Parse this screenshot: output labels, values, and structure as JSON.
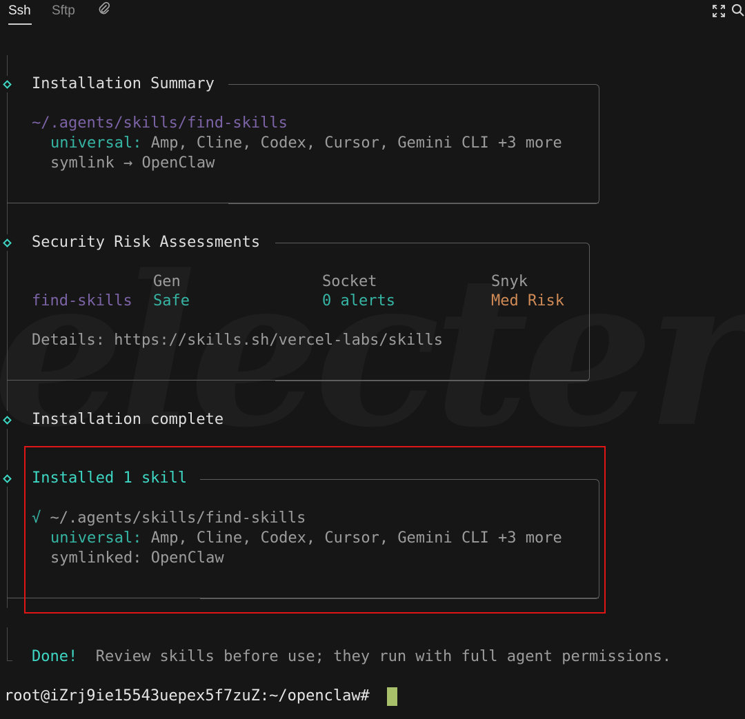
{
  "tabs": [
    {
      "label": "Ssh",
      "active": true
    },
    {
      "label": "Sftp",
      "active": false
    }
  ],
  "toolbar_icons": {
    "attach": "paperclip-icon",
    "fullscreen": "expand-icon",
    "search": "search-icon"
  },
  "watermark": "electerm",
  "summary": {
    "title": "Installation Summary",
    "path": "~/.agents/skills/find-skills",
    "universal_label": "universal:",
    "agents": " Amp, Cline, Codex, Cursor, Gemini CLI +3 more",
    "symlink": "symlink → OpenClaw"
  },
  "security": {
    "title": "Security Risk Assessments",
    "headers": {
      "gen": "Gen",
      "socket": "Socket",
      "snyk": "Snyk"
    },
    "row": {
      "name": "find-skills",
      "gen": "Safe",
      "socket": "0 alerts",
      "snyk": "Med Risk"
    },
    "details": "Details: https://skills.sh/vercel-labs/skills"
  },
  "complete": "Installation complete",
  "installed": {
    "title": "Installed 1 skill",
    "check": "√",
    "path": " ~/.agents/skills/find-skills",
    "universal_label": "universal:",
    "agents": " Amp, Cline, Codex, Cursor, Gemini CLI +3 more",
    "symlinked": "symlinked: OpenClaw"
  },
  "done": {
    "label": "Done!",
    "message": "  Review skills before use; they run with full agent permissions."
  },
  "prompt": "root@iZrj9ie15543uepex5f7zuZ:~/openclaw#",
  "colors": {
    "accent": "#3ed7c4",
    "path": "#7b63a6",
    "safe": "#36b5a4",
    "risk": "#cf8a56",
    "highlight": "#e01515",
    "cursor": "#a9c06b"
  }
}
